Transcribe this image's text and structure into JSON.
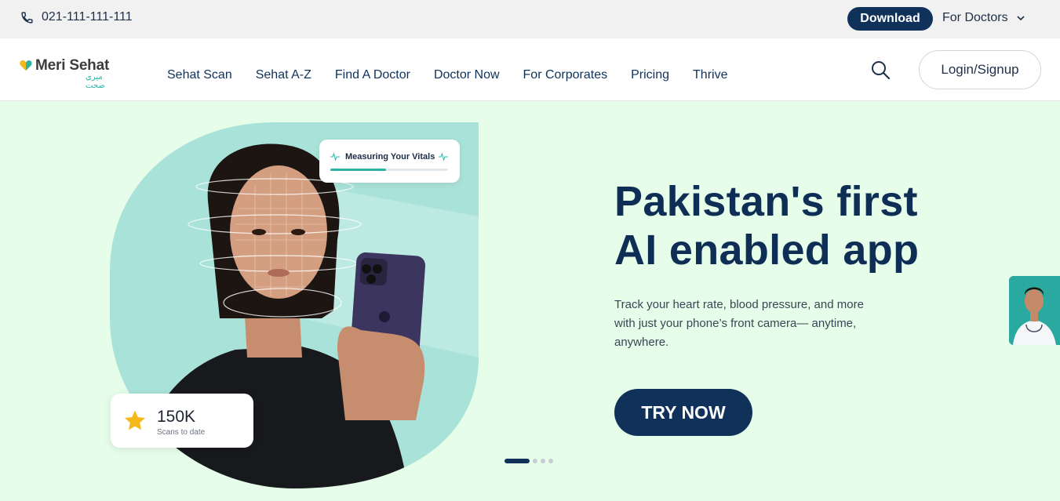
{
  "topbar": {
    "phone": "021-111-111-111",
    "download_label": "Download",
    "for_doctors_label": "For Doctors"
  },
  "nav": {
    "logo_text": "Meri Sehat",
    "logo_sub": "میری صحت",
    "links": [
      "Sehat Scan",
      "Sehat A-Z",
      "Find A Doctor",
      "Doctor Now",
      "For Corporates",
      "Pricing",
      "Thrive"
    ],
    "login_label": "Login/Signup"
  },
  "hero": {
    "title_line1": "Pakistan's first",
    "title_line2": "AI enabled app",
    "subtitle": "Track your heart rate, blood pressure, and more with just your phone’s front camera— anytime, anywhere.",
    "cta_label": "TRY NOW",
    "vitals_label": "Measuring Your Vitals",
    "vitals_progress": 0.47,
    "scans_count": "150K",
    "scans_label": "Scans to date"
  },
  "carousel": {
    "total": 4,
    "active": 0
  },
  "colors": {
    "brand_navy": "#10325a",
    "accent_teal": "#2cb3a4",
    "hero_bg": "#e6fde9",
    "star": "#f5b81b"
  },
  "icons": [
    "phone-icon",
    "chevron-down-icon",
    "search-icon",
    "heart-logo-icon",
    "pulse-icon",
    "star-icon"
  ]
}
